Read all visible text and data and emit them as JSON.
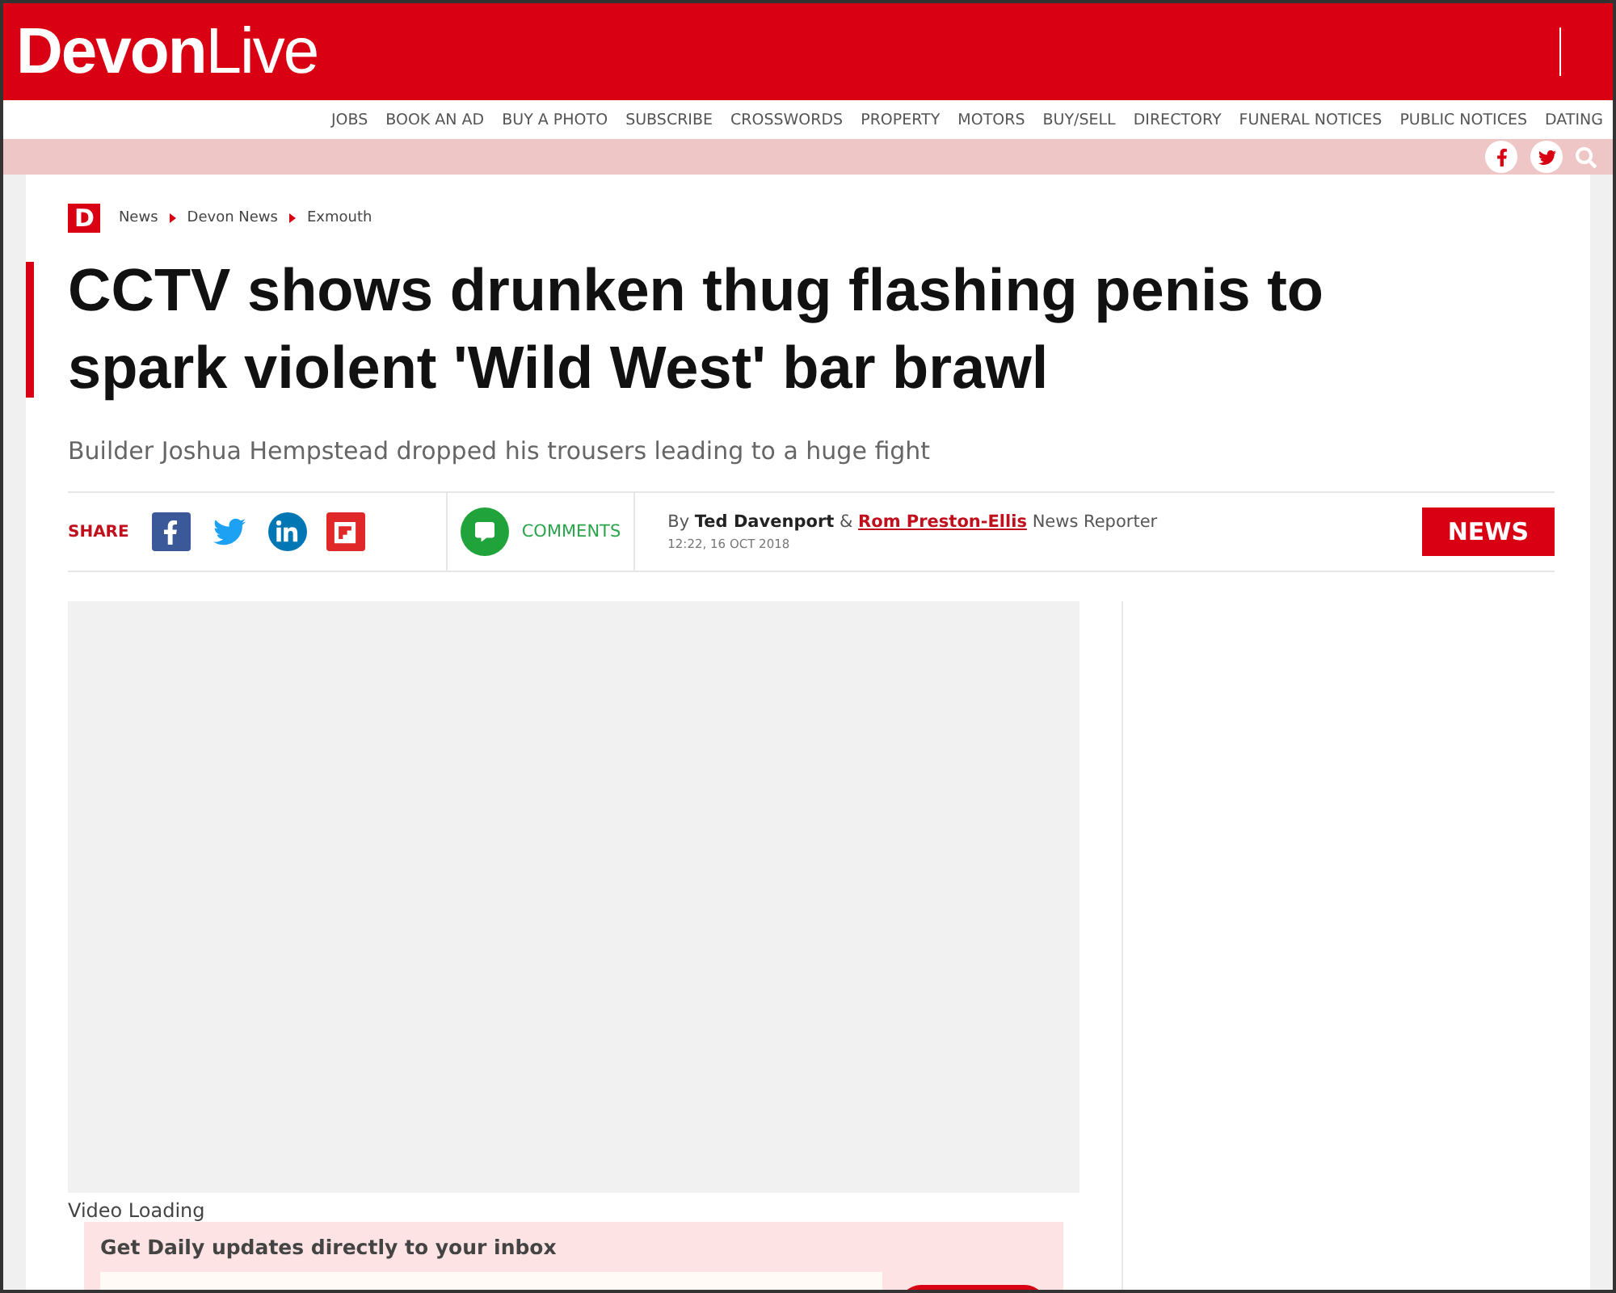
{
  "header": {
    "logo_bold": "Devon",
    "logo_light": "Live"
  },
  "utility_links": [
    "JOBS",
    "BOOK AN AD",
    "BUY A PHOTO",
    "SUBSCRIBE",
    "CROSSWORDS",
    "PROPERTY",
    "MOTORS",
    "BUY/SELL",
    "DIRECTORY",
    "FUNERAL NOTICES",
    "PUBLIC NOTICES",
    "DATING"
  ],
  "breadcrumb": {
    "badge": "D",
    "items": [
      "News",
      "Devon News",
      "Exmouth"
    ]
  },
  "article": {
    "headline": "CCTV shows drunken thug flashing penis to spark violent 'Wild West' bar brawl",
    "standfirst": "Builder Joshua Hempstead dropped his trousers leading to a huge fight"
  },
  "share_bar": {
    "share_label": "SHARE",
    "comments_label": "COMMENTS",
    "byline_prefix": "By",
    "author_1": "Ted Davenport",
    "joiner": "&",
    "author_2": "Rom Preston-Ellis",
    "role": "News Reporter",
    "timestamp": "12:22, 16 OCT 2018",
    "section_tag": "NEWS"
  },
  "video": {
    "status": "Video Loading"
  },
  "newsletter": {
    "text": "Get **Daily** updates directly to your inbox"
  }
}
